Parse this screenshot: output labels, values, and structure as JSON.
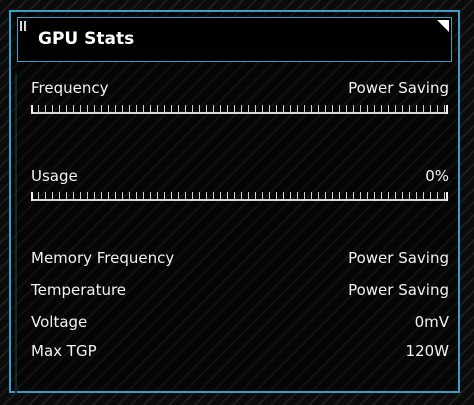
{
  "panel": {
    "title": "GPU Stats"
  },
  "sliders": [
    {
      "label": "Frequency",
      "value": "Power Saving",
      "level": 0
    },
    {
      "label": "Usage",
      "value": "0%",
      "level": 0
    }
  ],
  "stats": [
    {
      "label": "Memory Frequency",
      "value": "Power Saving"
    },
    {
      "label": "Temperature",
      "value": "Power Saving"
    },
    {
      "label": "Voltage",
      "value": "0mV"
    },
    {
      "label": "Max TGP",
      "value": "120W"
    }
  ],
  "colors": {
    "accent": "#3a9ec4",
    "text": "#f2f2f2",
    "background": "#0b0b0c"
  },
  "icons": {
    "grip": "drag-handle-icon",
    "corner": "collapse-corner-icon"
  }
}
